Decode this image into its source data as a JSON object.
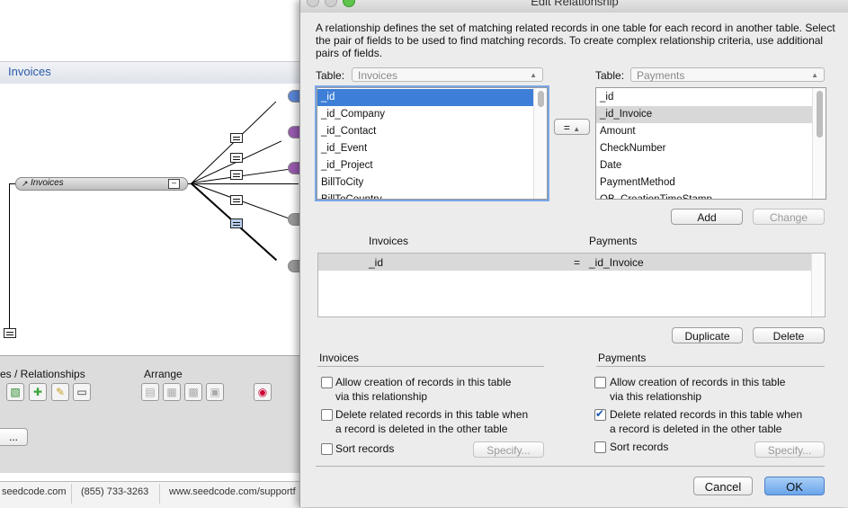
{
  "graph": {
    "title": "Invoices",
    "occurrence_label": "Invoices"
  },
  "bottom_bar": {
    "relationships_label": "es / Relationships",
    "arrange_label": "Arrange",
    "more_button": "..."
  },
  "status_bar": {
    "site": "seedcode.com",
    "phone": "(855) 733-3263",
    "url": "www.seedcode.com/supportf"
  },
  "dialog": {
    "title": "Edit Relationship",
    "description": "A relationship defines the set of matching related records in one table for each record in another table. Select the pair of fields to be used to find matching records. To create complex relationship criteria, use additional pairs of fields.",
    "left_table_label": "Table:",
    "left_table_value": "Invoices",
    "right_table_label": "Table:",
    "right_table_value": "Payments",
    "left_fields": [
      "_id",
      "_id_Company",
      "_id_Contact",
      "_id_Event",
      "_id_Project",
      "BillToCity",
      "BillToCountry"
    ],
    "right_fields": [
      "_id",
      "_id_Invoice",
      "Amount",
      "CheckNumber",
      "Date",
      "PaymentMethod",
      "QB_CreationTimeStamp"
    ],
    "operator": "=",
    "add_button": "Add",
    "change_button": "Change",
    "criteria_header_left": "Invoices",
    "criteria_header_right": "Payments",
    "criteria_row": {
      "left": "_id",
      "op": "=",
      "right": "_id_Invoice"
    },
    "duplicate_button": "Duplicate",
    "delete_button": "Delete",
    "left_section_title": "Invoices",
    "right_section_title": "Payments",
    "left_options": {
      "allow_create_1": "Allow creation of records in this table",
      "allow_create_2": "via this relationship",
      "delete_related_1": "Delete related records in this table when",
      "delete_related_2": "a record is deleted in the other table",
      "sort": "Sort records",
      "specify": "Specify..."
    },
    "right_options": {
      "allow_create_1": "Allow creation of records in this table",
      "allow_create_2": "via this relationship",
      "delete_related_1": "Delete related records in this table when",
      "delete_related_2": "a record is deleted in the other table",
      "sort": "Sort records",
      "specify": "Specify..."
    },
    "cancel_button": "Cancel",
    "ok_button": "OK"
  }
}
